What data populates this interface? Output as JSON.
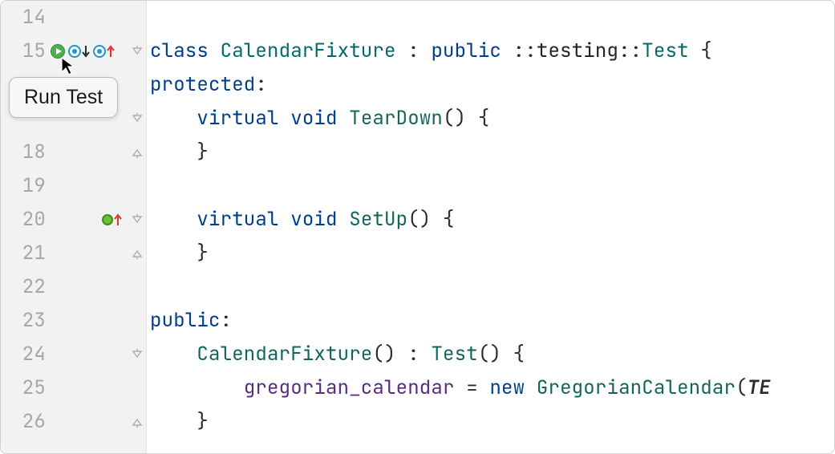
{
  "tooltip": "Run Test",
  "icons": {
    "run": "run-test-icon",
    "override_down": "override-down-icon",
    "override_up": "override-up-icon",
    "impl_up": "implements-up-icon",
    "fold_open": "fold-open-icon",
    "fold_close": "fold-close-icon"
  },
  "lines": [
    {
      "num": "14",
      "code": []
    },
    {
      "num": "15",
      "gutter": {
        "run": true,
        "override_down": true,
        "override_up": true
      },
      "fold": "open",
      "code": [
        {
          "cls": "kw",
          "t": "class"
        },
        {
          "t": " "
        },
        {
          "cls": "type",
          "t": "CalendarFixture"
        },
        {
          "t": " "
        },
        {
          "cls": "punct",
          "t": ":"
        },
        {
          "t": " "
        },
        {
          "cls": "kw",
          "t": "public"
        },
        {
          "t": " "
        },
        {
          "cls": "punct",
          "t": "::"
        },
        {
          "cls": "ident2",
          "t": "testing"
        },
        {
          "cls": "punct",
          "t": "::"
        },
        {
          "cls": "type",
          "t": "Test"
        },
        {
          "t": " "
        },
        {
          "cls": "punct",
          "t": "{"
        }
      ]
    },
    {
      "num": "",
      "code": [
        {
          "cls": "kw",
          "t": "protected"
        },
        {
          "cls": "punct",
          "t": ":"
        }
      ]
    },
    {
      "num": "",
      "fold": "open",
      "code": [
        {
          "t": "    "
        },
        {
          "cls": "kw",
          "t": "virtual"
        },
        {
          "t": " "
        },
        {
          "cls": "kw",
          "t": "void"
        },
        {
          "t": " "
        },
        {
          "cls": "fn",
          "t": "TearDown"
        },
        {
          "cls": "punct",
          "t": "()"
        },
        {
          "t": " "
        },
        {
          "cls": "punct",
          "t": "{"
        }
      ]
    },
    {
      "num": "18",
      "fold": "close",
      "code": [
        {
          "t": "    "
        },
        {
          "cls": "punct",
          "t": "}"
        }
      ]
    },
    {
      "num": "19",
      "code": []
    },
    {
      "num": "20",
      "gutter": {
        "impl_up": true
      },
      "fold": "open",
      "code": [
        {
          "t": "    "
        },
        {
          "cls": "kw",
          "t": "virtual"
        },
        {
          "t": " "
        },
        {
          "cls": "kw",
          "t": "void"
        },
        {
          "t": " "
        },
        {
          "cls": "fn",
          "t": "SetUp"
        },
        {
          "cls": "punct",
          "t": "()"
        },
        {
          "t": " "
        },
        {
          "cls": "punct",
          "t": "{"
        }
      ]
    },
    {
      "num": "21",
      "fold": "close",
      "code": [
        {
          "t": "    "
        },
        {
          "cls": "punct",
          "t": "}"
        }
      ]
    },
    {
      "num": "22",
      "code": []
    },
    {
      "num": "23",
      "code": [
        {
          "cls": "kw",
          "t": "public"
        },
        {
          "cls": "punct",
          "t": ":"
        }
      ]
    },
    {
      "num": "24",
      "fold": "open",
      "code": [
        {
          "t": "    "
        },
        {
          "cls": "fn",
          "t": "CalendarFixture"
        },
        {
          "cls": "punct",
          "t": "()"
        },
        {
          "t": " "
        },
        {
          "cls": "punct",
          "t": ":"
        },
        {
          "t": " "
        },
        {
          "cls": "fn",
          "t": "Test"
        },
        {
          "cls": "punct",
          "t": "()"
        },
        {
          "t": " "
        },
        {
          "cls": "punct",
          "t": "{"
        }
      ]
    },
    {
      "num": "25",
      "code": [
        {
          "t": "        "
        },
        {
          "cls": "ident",
          "t": "gregorian_calendar"
        },
        {
          "t": " "
        },
        {
          "cls": "punct",
          "t": "="
        },
        {
          "t": " "
        },
        {
          "cls": "kw-new",
          "t": "new"
        },
        {
          "t": " "
        },
        {
          "cls": "fn",
          "t": "GregorianCalendar"
        },
        {
          "cls": "punct",
          "t": "("
        },
        {
          "cls": "arg",
          "t": "TE"
        }
      ]
    },
    {
      "num": "26",
      "fold": "close",
      "code": [
        {
          "t": "    "
        },
        {
          "cls": "punct",
          "t": "}"
        }
      ]
    }
  ]
}
